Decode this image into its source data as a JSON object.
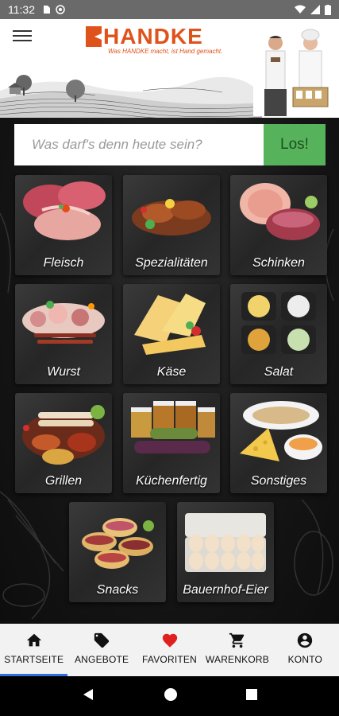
{
  "status_bar": {
    "time": "11:32"
  },
  "header": {
    "logo_text": "HANDKE",
    "tagline": "Was HANDKE macht, ist Hand gemacht."
  },
  "search": {
    "placeholder": "Was darf's denn heute sein?",
    "button_label": "Los!"
  },
  "categories": [
    {
      "label": "Fleisch"
    },
    {
      "label": "Spezialitäten"
    },
    {
      "label": "Schinken"
    },
    {
      "label": "Wurst"
    },
    {
      "label": "Käse"
    },
    {
      "label": "Salat"
    },
    {
      "label": "Grillen"
    },
    {
      "label": "Küchenfertig"
    },
    {
      "label": "Sonstiges"
    },
    {
      "label": "Snacks"
    },
    {
      "label": "Bauernhof-Eier"
    }
  ],
  "bottom_nav": [
    {
      "label": "STARTSEITE",
      "icon": "home-icon"
    },
    {
      "label": "ANGEBOTE",
      "icon": "tag-icon"
    },
    {
      "label": "FAVORITEN",
      "icon": "heart-icon"
    },
    {
      "label": "WARENKORB",
      "icon": "cart-icon"
    },
    {
      "label": "KONTO",
      "icon": "account-icon"
    }
  ],
  "colors": {
    "brand": "#e0521b",
    "search_button": "#56b35b",
    "favorite_heart": "#e02020",
    "active_indicator": "#2f6fde"
  }
}
